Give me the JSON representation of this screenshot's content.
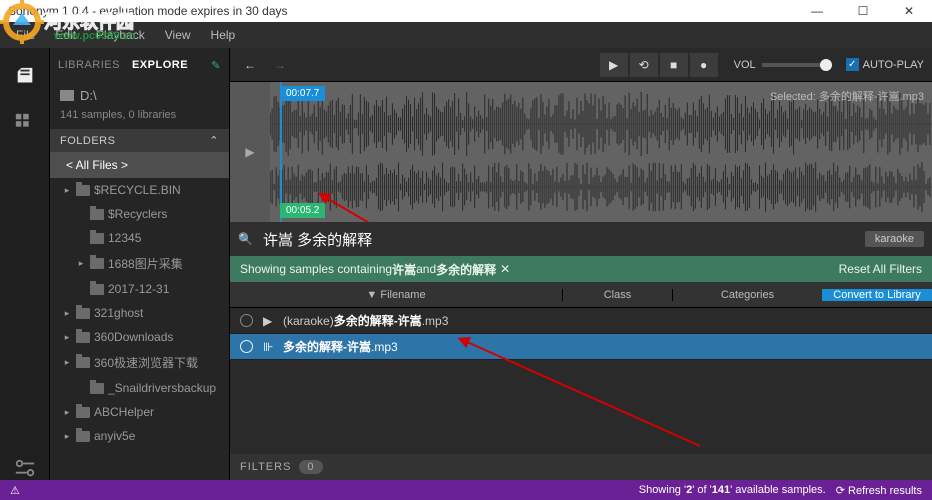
{
  "window": {
    "title": "Sononym 1.0.4 - evaluation mode expires in 30 days"
  },
  "menu": [
    "File",
    "Edit",
    "Playback",
    "View",
    "Help"
  ],
  "watermark": {
    "text": "河东软件园",
    "url": "www.pc0359.cn"
  },
  "sidebar": {
    "tabs": {
      "libraries": "LIBRARIES",
      "explore": "EXPLORE"
    },
    "drive": "D:\\",
    "driveinfo": "141 samples, 0 libraries",
    "folders_label": "FOLDERS",
    "allfiles": "< All Files >",
    "tree": [
      {
        "name": "$RECYCLE.BIN",
        "expand": true,
        "depth": 1
      },
      {
        "name": "$Recyclers",
        "depth": 2
      },
      {
        "name": "12345",
        "depth": 2
      },
      {
        "name": "1688图片采集",
        "expand": true,
        "depth": 2
      },
      {
        "name": "2017-12-31",
        "depth": 2
      },
      {
        "name": "321ghost",
        "expand": true,
        "depth": 1
      },
      {
        "name": "360Downloads",
        "expand": true,
        "depth": 1
      },
      {
        "name": "360极速浏览器下载",
        "expand": true,
        "depth": 1
      },
      {
        "name": "_Snaildriversbackup",
        "depth": 2
      },
      {
        "name": "ABCHelper",
        "expand": true,
        "depth": 1
      },
      {
        "name": "anyiv5e",
        "expand": true,
        "depth": 1
      }
    ]
  },
  "transport": {
    "vol": "VOL",
    "autoplay": "AUTO-PLAY"
  },
  "waveform": {
    "marker_top": "00:07.7",
    "marker_bottom": "00:05.2",
    "selected_prefix": "Selected:",
    "selected_name": "多余的解释-许嵩.mp3"
  },
  "search": {
    "term": "许嵩 多余的解释",
    "tag": "karaoke"
  },
  "filterbar": {
    "prefix": "Showing samples containing ",
    "t1": "许嵩",
    "mid": " and ",
    "t2": "多余的解释",
    "reset": "Reset All Filters"
  },
  "columns": {
    "filename": "Filename",
    "class": "Class",
    "categories": "Categories",
    "convert": "Convert to Library"
  },
  "rows": [
    {
      "prefix": "(karaoke)",
      "bold": "多余的解释-许嵩",
      "ext": ".mp3",
      "selected": false,
      "icon": "play"
    },
    {
      "prefix": "",
      "bold": "多余的解释-许嵩",
      "ext": ".mp3",
      "selected": true,
      "icon": "wave"
    }
  ],
  "filters_footer": {
    "label": "FILTERS",
    "count": "0"
  },
  "statusbar": {
    "msg_pre": "Showing '",
    "a": "2",
    "msg_mid": "' of '",
    "b": "141",
    "msg_post": "' available samples.",
    "refresh": "Refresh results"
  }
}
